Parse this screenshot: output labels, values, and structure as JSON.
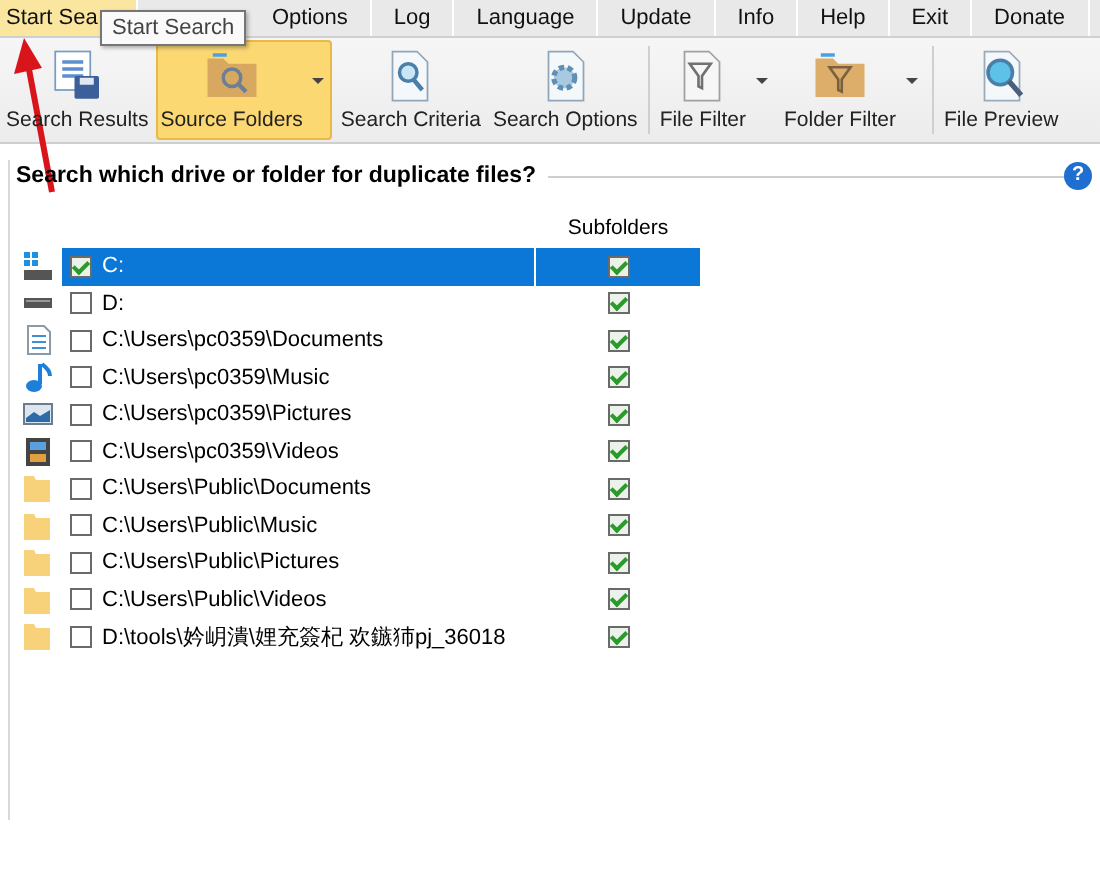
{
  "menu": [
    {
      "label": "Start Sea",
      "selected": true
    },
    {
      "label": "Options",
      "selected": false
    },
    {
      "label": "Log",
      "selected": false
    },
    {
      "label": "Language",
      "selected": false
    },
    {
      "label": "Update",
      "selected": false
    },
    {
      "label": "Info",
      "selected": false
    },
    {
      "label": "Help",
      "selected": false
    },
    {
      "label": "Exit",
      "selected": false
    },
    {
      "label": "Donate",
      "selected": false
    }
  ],
  "tooltip": "Start Search",
  "toolbar": [
    {
      "label": "Search Results",
      "kind": "results",
      "selected": false,
      "dropdown": false,
      "separator": false
    },
    {
      "label": "Source Folders",
      "kind": "folder",
      "selected": true,
      "dropdown": true,
      "separator": false
    },
    {
      "label": "Search Criteria",
      "kind": "criteria",
      "selected": false,
      "dropdown": false,
      "separator": false
    },
    {
      "label": "Search Options",
      "kind": "options",
      "selected": false,
      "dropdown": false,
      "separator": true
    },
    {
      "label": "File Filter",
      "kind": "filefilter",
      "selected": false,
      "dropdown": true,
      "separator": false
    },
    {
      "label": "Folder Filter",
      "kind": "folderfilter",
      "selected": false,
      "dropdown": true,
      "separator": true
    },
    {
      "label": "File Preview",
      "kind": "preview",
      "selected": false,
      "dropdown": false,
      "separator": false
    }
  ],
  "group": {
    "title": "Search which drive or folder for duplicate files?",
    "help": "?"
  },
  "table": {
    "columns": [
      "Subfolders"
    ],
    "rows": [
      {
        "kind": "windrive",
        "path": "C:",
        "checked": true,
        "subfolders": true,
        "selected": true
      },
      {
        "kind": "drive",
        "path": "D:",
        "checked": false,
        "subfolders": true,
        "selected": false
      },
      {
        "kind": "documents",
        "path": "C:\\Users\\pc0359\\Documents",
        "checked": false,
        "subfolders": true,
        "selected": false
      },
      {
        "kind": "music",
        "path": "C:\\Users\\pc0359\\Music",
        "checked": false,
        "subfolders": true,
        "selected": false
      },
      {
        "kind": "pictures",
        "path": "C:\\Users\\pc0359\\Pictures",
        "checked": false,
        "subfolders": true,
        "selected": false
      },
      {
        "kind": "videos",
        "path": "C:\\Users\\pc0359\\Videos",
        "checked": false,
        "subfolders": true,
        "selected": false
      },
      {
        "kind": "folder",
        "path": "C:\\Users\\Public\\Documents",
        "checked": false,
        "subfolders": true,
        "selected": false
      },
      {
        "kind": "folder",
        "path": "C:\\Users\\Public\\Music",
        "checked": false,
        "subfolders": true,
        "selected": false
      },
      {
        "kind": "folder",
        "path": "C:\\Users\\Public\\Pictures",
        "checked": false,
        "subfolders": true,
        "selected": false
      },
      {
        "kind": "folder",
        "path": "C:\\Users\\Public\\Videos",
        "checked": false,
        "subfolders": true,
        "selected": false
      },
      {
        "kind": "folder",
        "path": "D:\\tools\\妗岄潰\\娌充簽杞  欢鏃犻pj_36018",
        "checked": false,
        "subfolders": true,
        "selected": false
      }
    ]
  }
}
